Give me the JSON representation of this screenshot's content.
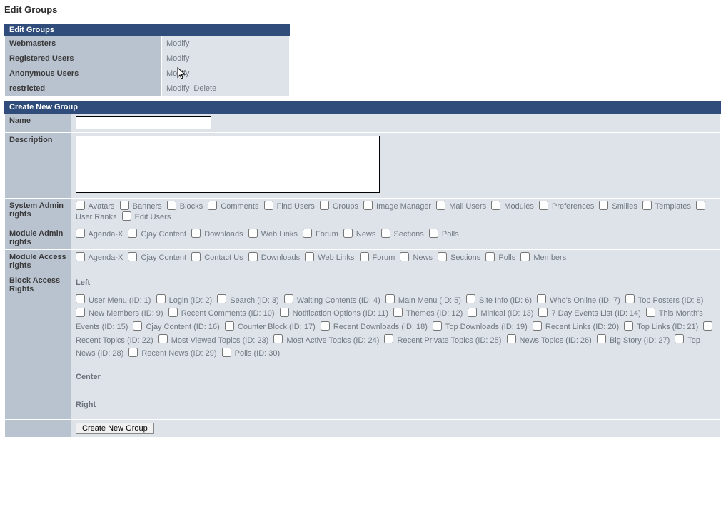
{
  "pageTitle": "Edit Groups",
  "editGroups": {
    "header": "Edit Groups",
    "rows": [
      {
        "name": "Webmasters",
        "actions": [
          "Modify"
        ]
      },
      {
        "name": "Registered Users",
        "actions": [
          "Modify"
        ]
      },
      {
        "name": "Anonymous Users",
        "actions": [
          "Modify"
        ]
      },
      {
        "name": "restricted",
        "actions": [
          "Modify",
          "Delete"
        ]
      }
    ]
  },
  "createGroup": {
    "header": "Create New Group",
    "name": {
      "label": "Name",
      "value": ""
    },
    "description": {
      "label": "Description",
      "value": ""
    },
    "systemAdmin": {
      "label": "System Admin rights",
      "items": [
        "Avatars",
        "Banners",
        "Blocks",
        "Comments",
        "Find Users",
        "Groups",
        "Image Manager",
        "Mail Users",
        "Modules",
        "Preferences",
        "Smilies",
        "Templates",
        "User Ranks",
        "Edit Users"
      ]
    },
    "moduleAdmin": {
      "label": "Module Admin rights",
      "items": [
        "Agenda-X",
        "Cjay Content",
        "Downloads",
        "Web Links",
        "Forum",
        "News",
        "Sections",
        "Polls"
      ]
    },
    "moduleAccess": {
      "label": "Module Access rights",
      "items": [
        "Agenda-X",
        "Cjay Content",
        "Contact Us",
        "Downloads",
        "Web Links",
        "Forum",
        "News",
        "Sections",
        "Polls",
        "Members"
      ]
    },
    "blockAccess": {
      "label": "Block Access Rights",
      "left": {
        "label": "Left",
        "items": [
          "User Menu (ID: 1)",
          "Login (ID: 2)",
          "Search (ID: 3)",
          "Waiting Contents (ID: 4)",
          "Main Menu (ID: 5)",
          "Site Info (ID: 6)",
          "Who's Online (ID: 7)",
          "Top Posters (ID: 8)",
          "New Members (ID: 9)",
          "Recent Comments (ID: 10)",
          "Notification Options (ID: 11)",
          "Themes (ID: 12)",
          "Minical (ID: 13)",
          "7 Day Events List (ID: 14)",
          "This Month's Events (ID: 15)",
          "Cjay Content (ID: 16)",
          "Counter Block (ID: 17)",
          "Recent Downloads (ID: 18)",
          "Top Downloads (ID: 19)",
          "Recent Links (ID: 20)",
          "Top Links (ID: 21)",
          "Recent Topics (ID: 22)",
          "Most Viewed Topics (ID: 23)",
          "Most Active Topics (ID: 24)",
          "Recent Private Topics (ID: 25)",
          "News Topics (ID: 26)",
          "Big Story (ID: 27)",
          "Top News (ID: 28)",
          "Recent News (ID: 29)",
          "Polls (ID: 30)"
        ]
      },
      "center": {
        "label": "Center"
      },
      "right": {
        "label": "Right"
      }
    },
    "submitLabel": "Create New Group"
  }
}
